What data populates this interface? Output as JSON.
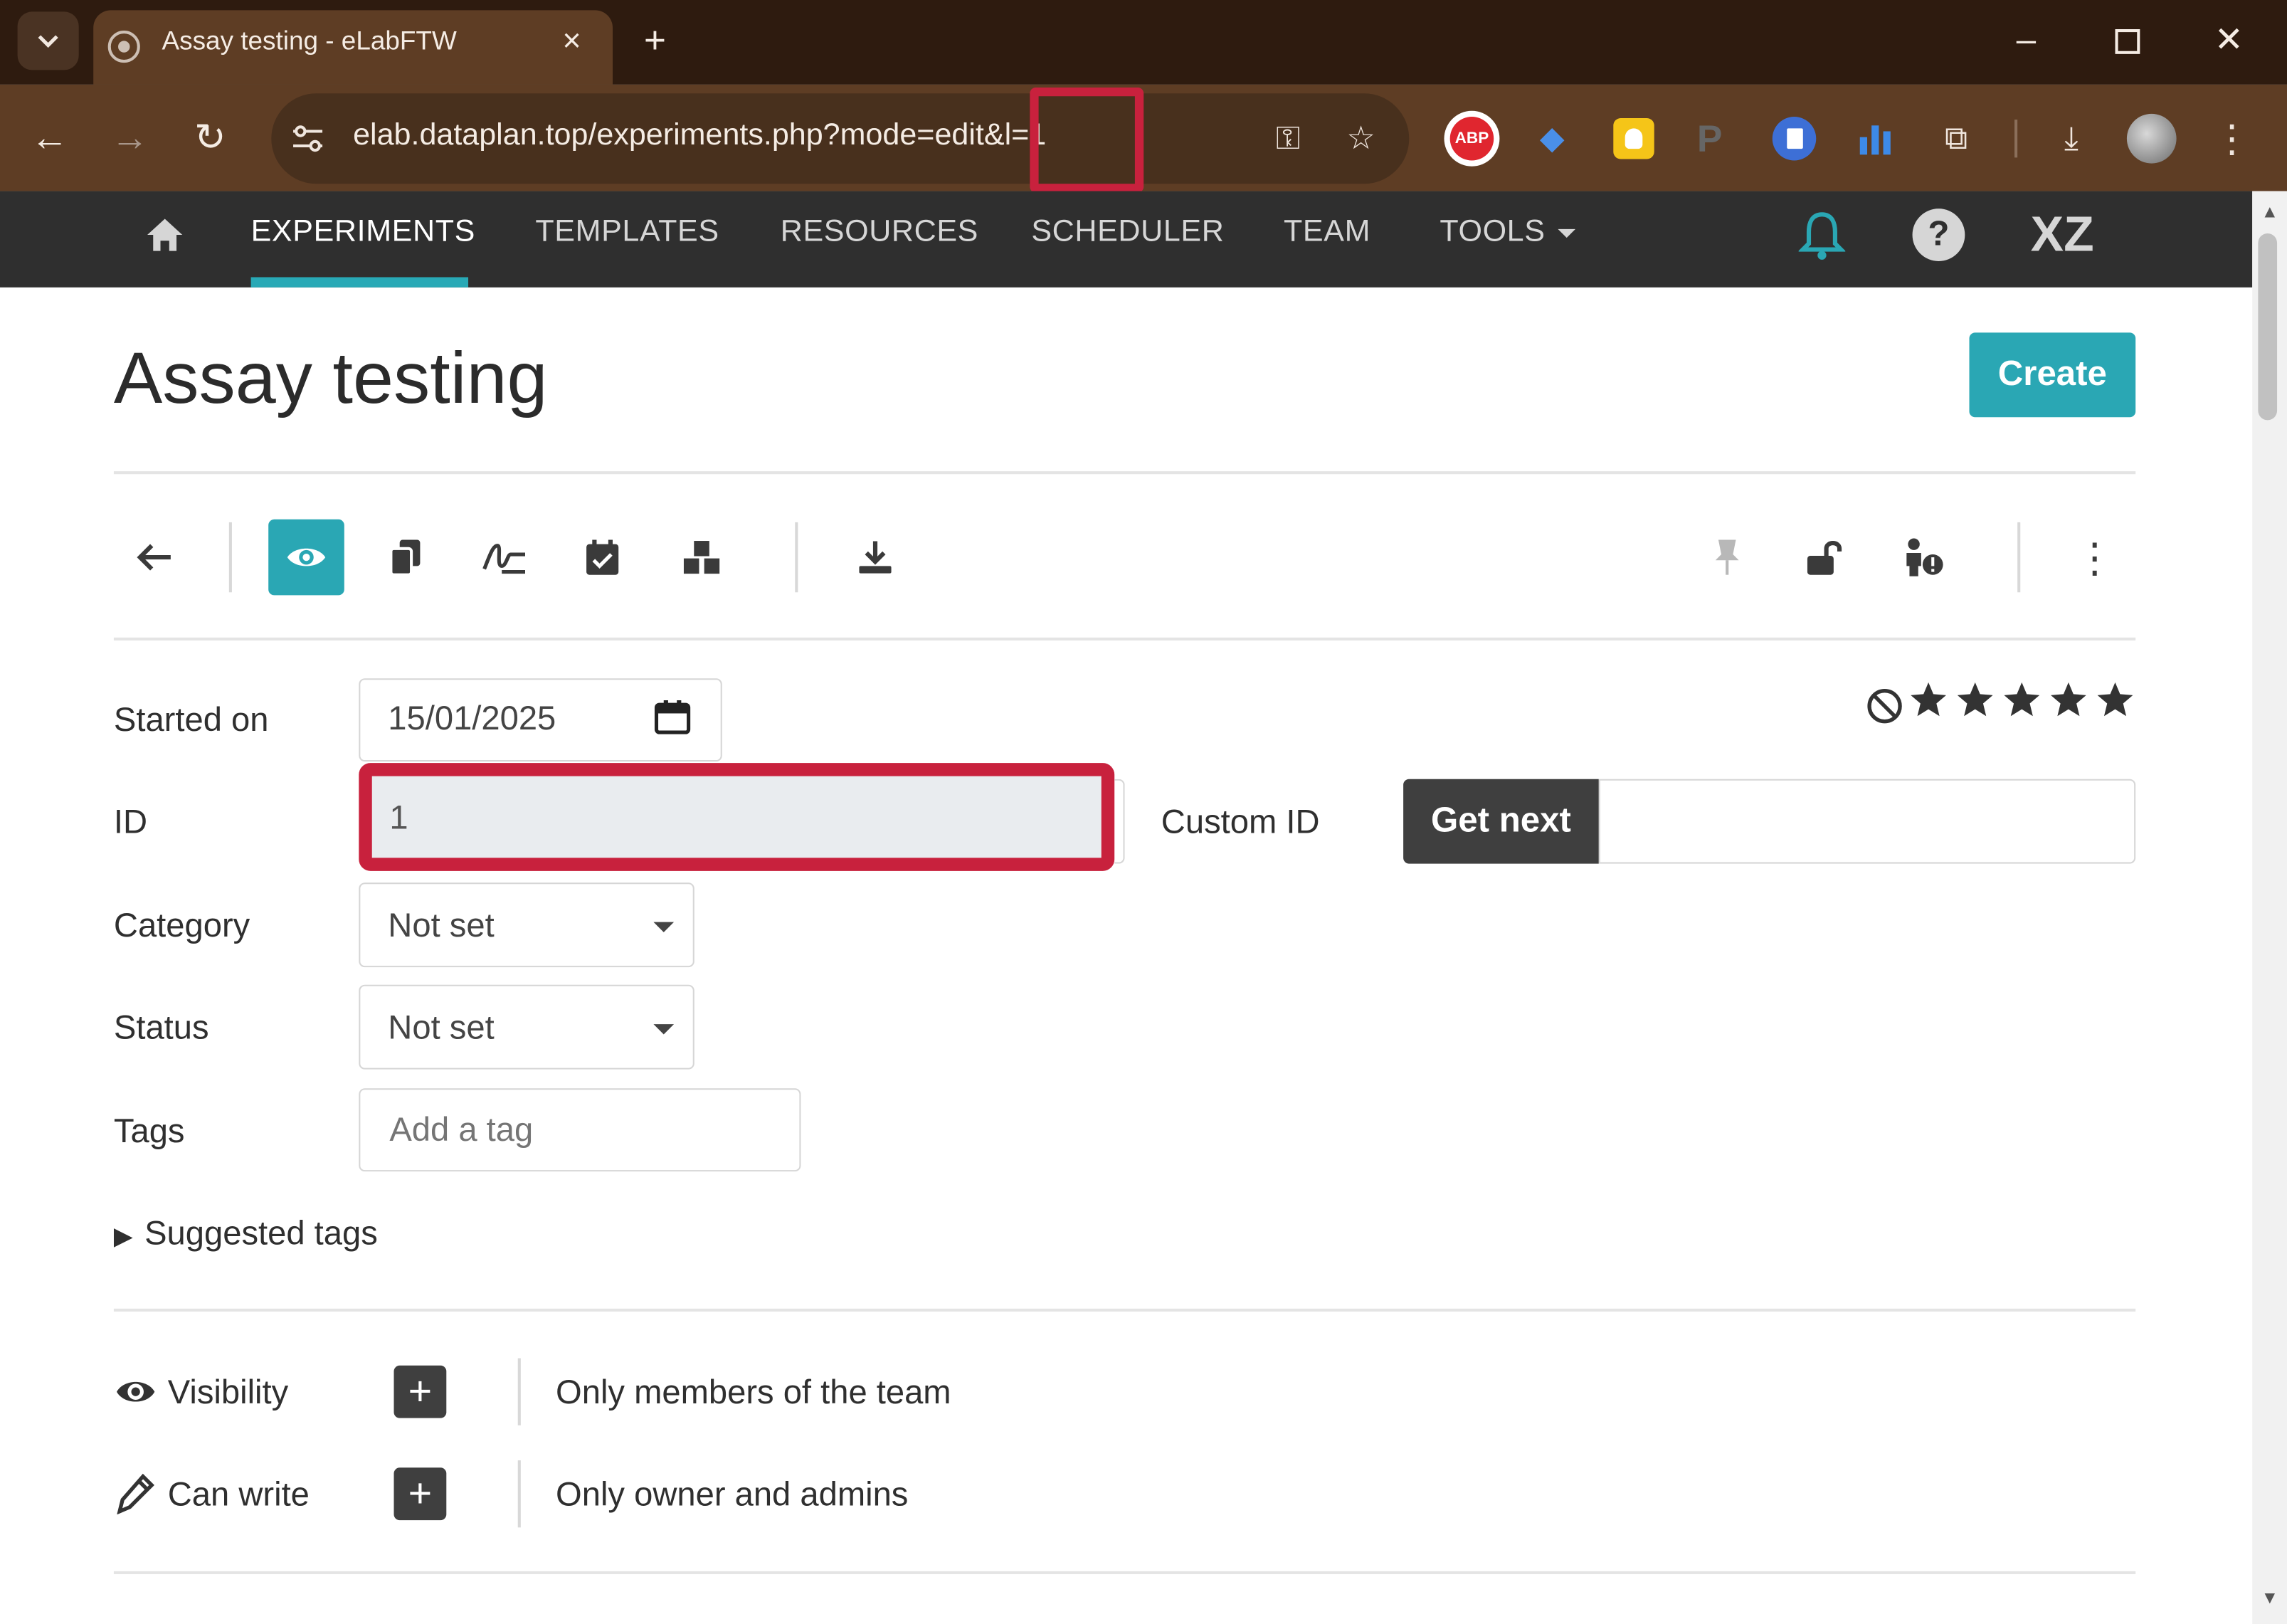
{
  "browser": {
    "tab_title": "Assay testing - eLabFTW",
    "url": "elab.dataplan.top/experiments.php?mode=edit&",
    "url_tail": "l=1",
    "extensions": [
      "abp-icon",
      "graduation-cap-icon",
      "bulb-icon",
      "p-icon",
      "doc-icon",
      "chart-icon",
      "puzzle-icon"
    ]
  },
  "app_nav": {
    "items": [
      "EXPERIMENTS",
      "TEMPLATES",
      "RESOURCES",
      "SCHEDULER",
      "TEAM",
      "TOOLS"
    ],
    "user_initials": "XZ"
  },
  "page": {
    "title": "Assay testing",
    "create_label": "Create"
  },
  "form": {
    "started_on_label": "Started on",
    "started_on_value": "15/01/2025",
    "id_label": "ID",
    "id_value": "1",
    "custom_id_label": "Custom ID",
    "get_next_label": "Get next",
    "category_label": "Category",
    "category_value": "Not set",
    "status_label": "Status",
    "status_value": "Not set",
    "tags_label": "Tags",
    "tags_placeholder": "Add a tag",
    "suggested_tags_label": "Suggested tags"
  },
  "rating": {
    "stars": 5,
    "value": 0
  },
  "permissions": {
    "visibility_label": "Visibility",
    "visibility_value": "Only members of the team",
    "can_write_label": "Can write",
    "can_write_value": "Only owner and admins"
  },
  "colors": {
    "accent": "#2aa7b4",
    "highlight": "#c8213d",
    "nav_bg": "#2f2f2f",
    "browser_bg": "#5e3d24"
  }
}
